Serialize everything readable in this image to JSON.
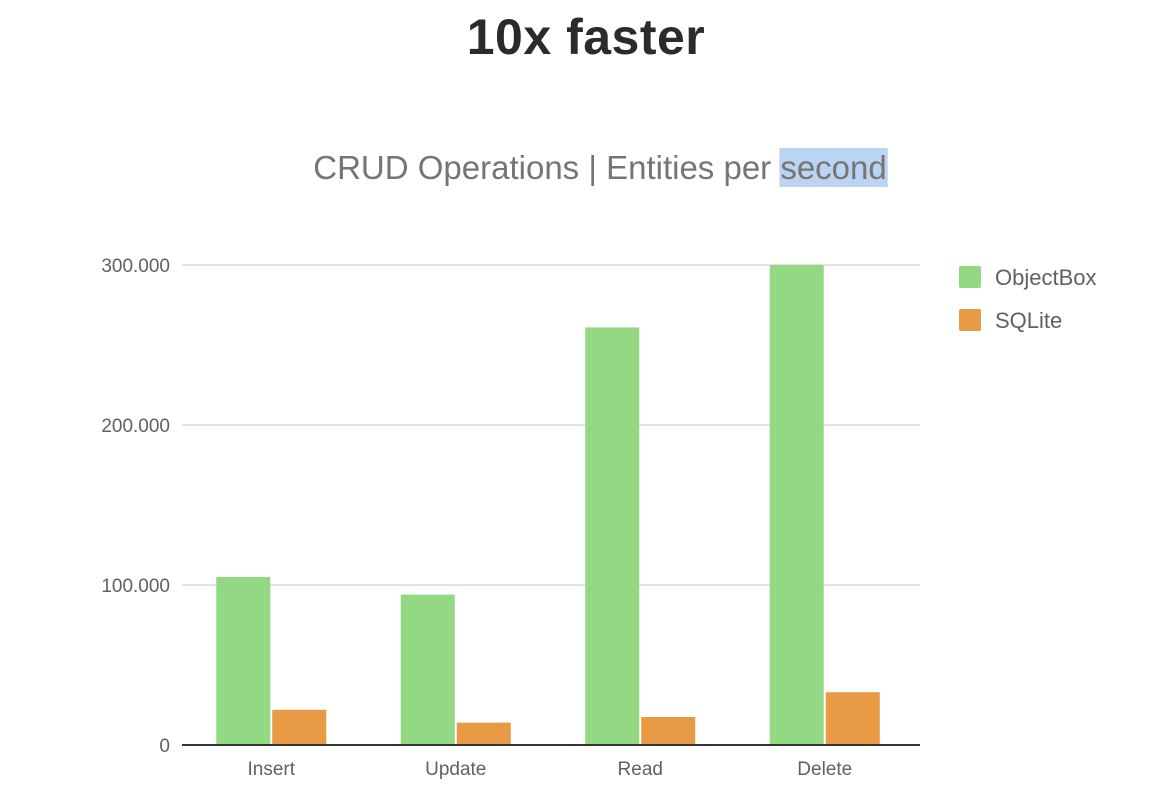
{
  "page_title": "10x faster",
  "chart_data": {
    "type": "bar",
    "title": "CRUD Operations | Entities per second",
    "title_highlighted_word": "second",
    "categories": [
      "Insert",
      "Update",
      "Read",
      "Delete"
    ],
    "series": [
      {
        "name": "ObjectBox",
        "color": "#93d983",
        "values": [
          105000,
          94000,
          261000,
          300000
        ]
      },
      {
        "name": "SQLite",
        "color": "#e99a45",
        "values": [
          22000,
          14000,
          17500,
          33000
        ]
      }
    ],
    "ylim": [
      0,
      300000
    ],
    "yticks": [
      0,
      100000,
      200000,
      300000
    ],
    "ytick_labels": [
      "0",
      "100.000",
      "200.000",
      "300.000"
    ],
    "xlabel": "",
    "ylabel": "",
    "grid": true,
    "legend_position": "right"
  },
  "colors": {
    "gridline": "#d9d9d9",
    "baseline": "#333333",
    "text_selection": "#bcd4f3"
  }
}
